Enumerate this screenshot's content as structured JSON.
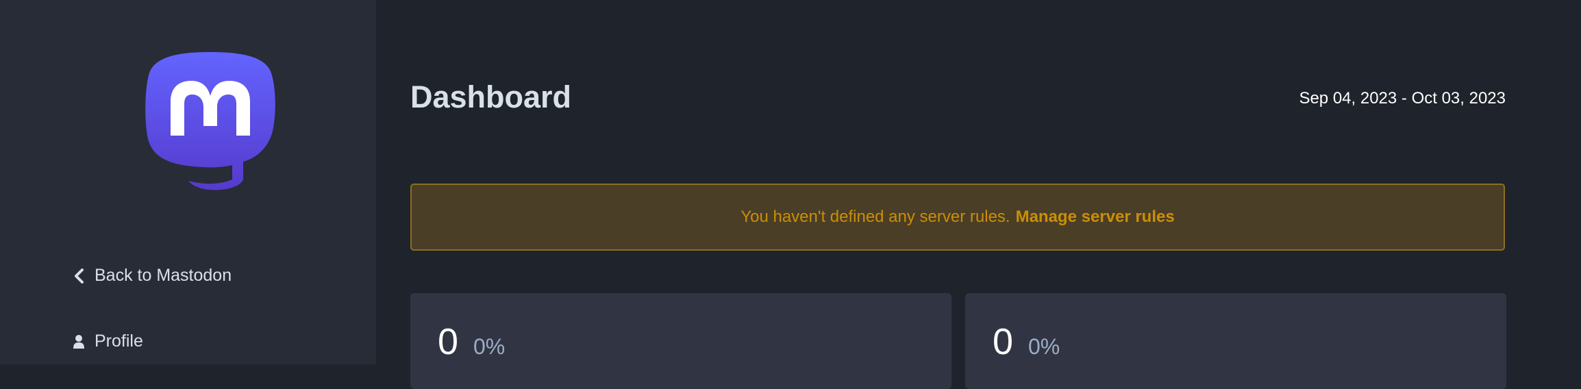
{
  "sidebar": {
    "logo_icon": "mastodon-logo-icon",
    "items": [
      {
        "label": "Back to Mastodon",
        "icon": "chevron-left-icon"
      },
      {
        "label": "Profile",
        "icon": "user-icon"
      }
    ]
  },
  "main": {
    "title": "Dashboard",
    "date_range": "Sep 04, 2023 - Oct 03, 2023",
    "warning": {
      "text": "You haven't defined any server rules.",
      "link_label": "Manage server rules"
    },
    "cards": [
      {
        "value": "0",
        "change": "0%"
      },
      {
        "value": "0",
        "change": "0%"
      }
    ]
  },
  "colors": {
    "sidebar_bg": "#282c37",
    "main_bg": "#1f232b",
    "brand": "#6364ff",
    "warning_bg": "#4b3e27",
    "warning_text": "#ca8f04",
    "card_bg": "#313543"
  }
}
